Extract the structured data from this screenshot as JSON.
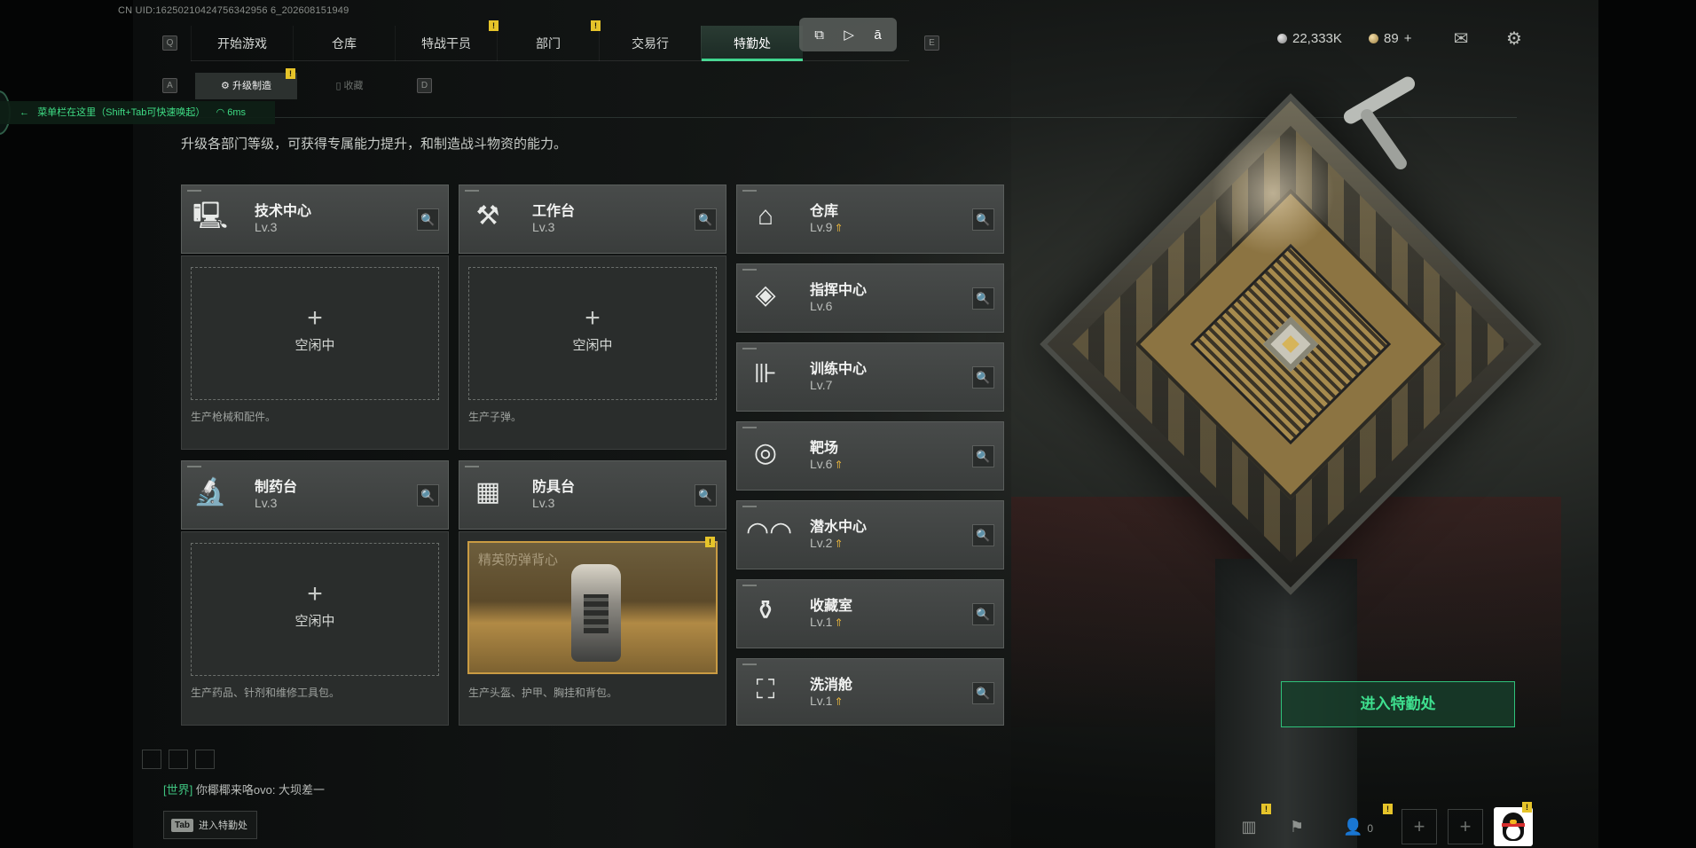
{
  "uid_text": "CN UID:16250210424756342956 6_202608151949",
  "nav": {
    "key_left": "Q",
    "key_right": "E",
    "tabs": [
      {
        "label": "开始游戏"
      },
      {
        "label": "仓库"
      },
      {
        "label": "特战干员"
      },
      {
        "label": "部门"
      },
      {
        "label": "交易行"
      },
      {
        "label": "特勤处"
      }
    ],
    "badge_mark": "!"
  },
  "currency": {
    "silver": "22,333K",
    "gold": "89",
    "gold_add": "+"
  },
  "subtabs": {
    "key_left": "A",
    "key_right": "D",
    "active": "升级制造",
    "inactive": "收藏"
  },
  "menu_hint": {
    "text": "菜单栏在这里（Shift+Tab可快速唤起）",
    "ping": "6ms"
  },
  "description": "升级各部门等级，可获得专属能力提升，和制造战斗物资的能力。",
  "workstations": [
    {
      "name": "技术中心",
      "level": "Lv.3",
      "icon": "computer-icon",
      "idle_label": "空闲中",
      "desc": "生产枪械和配件。"
    },
    {
      "name": "工作台",
      "level": "Lv.3",
      "icon": "tools-icon",
      "idle_label": "空闲中",
      "desc": "生产子弹。"
    },
    {
      "name": "制药台",
      "level": "Lv.3",
      "icon": "microscope-icon",
      "idle_label": "空闲中",
      "desc": "生产药品、针剂和维修工具包。"
    },
    {
      "name": "防具台",
      "level": "Lv.3",
      "icon": "boxes-icon",
      "product": "精英防弹背心",
      "desc": "生产头盔、护甲、胸挂和背包。"
    }
  ],
  "departments": [
    {
      "name": "仓库",
      "level": "Lv.9",
      "upgradable": true,
      "icon": "warehouse-icon"
    },
    {
      "name": "指挥中心",
      "level": "Lv.6",
      "upgradable": false,
      "icon": "command-icon"
    },
    {
      "name": "训练中心",
      "level": "Lv.7",
      "upgradable": false,
      "icon": "dumbbell-icon"
    },
    {
      "name": "靶场",
      "level": "Lv.6",
      "upgradable": true,
      "icon": "target-icon"
    },
    {
      "name": "潜水中心",
      "level": "Lv.2",
      "upgradable": true,
      "icon": "diving-mask-icon"
    },
    {
      "name": "收藏室",
      "level": "Lv.1",
      "upgradable": true,
      "icon": "collection-icon"
    },
    {
      "name": "洗消舱",
      "level": "Lv.1",
      "upgradable": true,
      "icon": "decontamination-icon"
    }
  ],
  "enter_button": "进入特勤处",
  "chat": {
    "channel": "[世界]",
    "message": "你椰椰来咯ovo: 大坝差一"
  },
  "tab_hint": {
    "key": "Tab",
    "label": "进入特勤处"
  },
  "bottom_bar": {
    "friends_count": "0"
  },
  "colors": {
    "accent_green": "#3fd58e",
    "upgrade_gold": "#e2b13c",
    "badge_yellow": "#e6c42a"
  }
}
